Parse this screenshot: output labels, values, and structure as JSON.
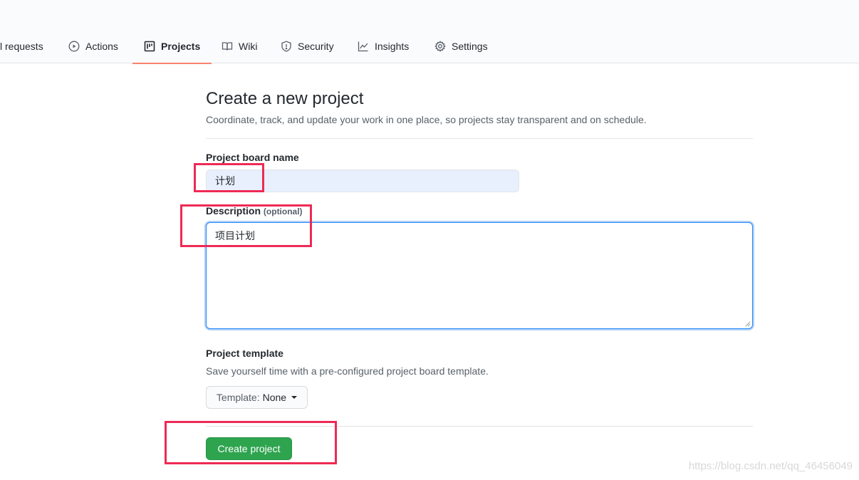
{
  "nav": {
    "tabs": [
      {
        "label": "l requests",
        "icon": "pull-request-icon"
      },
      {
        "label": "Actions",
        "icon": "play-icon"
      },
      {
        "label": "Projects",
        "icon": "project-icon",
        "selected": true
      },
      {
        "label": "Wiki",
        "icon": "book-icon"
      },
      {
        "label": "Security",
        "icon": "shield-icon"
      },
      {
        "label": "Insights",
        "icon": "graph-icon"
      },
      {
        "label": "Settings",
        "icon": "gear-icon"
      }
    ]
  },
  "form": {
    "title": "Create a new project",
    "subtitle": "Coordinate, track, and update your work in one place, so projects stay transparent and on schedule.",
    "name_label": "Project board name",
    "name_value": "计划",
    "description_label": "Description",
    "description_optional": "(optional)",
    "description_value": "项目计划",
    "template_label": "Project template",
    "template_note": "Save yourself time with a pre-configured project board template.",
    "template_button_prefix": "Template:",
    "template_button_value": "None",
    "create_button": "Create project"
  },
  "watermark": "https://blog.csdn.net/qq_46456049",
  "colors": {
    "accent_underline": "#f9826c",
    "primary_button": "#2ea44f",
    "annotation": "#ee2a55",
    "focus_border": "#2188ff"
  }
}
